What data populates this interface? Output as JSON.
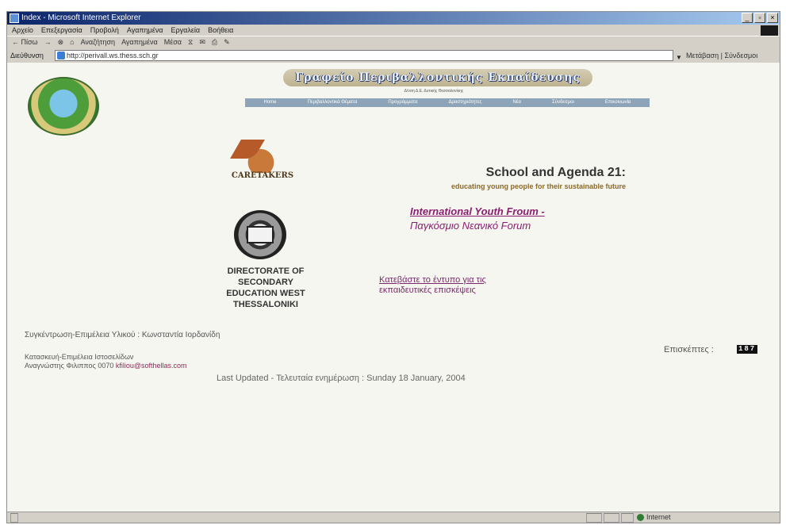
{
  "window": {
    "title": "Index - Microsoft Internet Explorer",
    "buttons": [
      "_",
      "▫",
      "×"
    ]
  },
  "menu": [
    "Αρχείο",
    "Επεξεργασία",
    "Προβολή",
    "Αγαπημένα",
    "Εργαλεία",
    "Βοήθεια"
  ],
  "toolbar": [
    "← Πίσω",
    "→",
    "⊗",
    "⌂",
    "Αναζήτηση",
    "Αγαπημένα",
    "Μέσα",
    "⧖",
    "✉",
    "⎙",
    "✎"
  ],
  "address": {
    "label": "Διεύθυνση",
    "url": "http://perivall.ws.thess.sch.gr",
    "go_label": "Μετάβαση",
    "links_label": "Σύνδεσμοι"
  },
  "page": {
    "banner": "Γραφείο Περιβαλλοντικής Εκπαίδευσης",
    "banner_sub": "Δ/νση Δ.Ε. Δυτικής Θεσσαλονίκης",
    "nav": [
      "Home",
      "Περιβαλλοντικά Θέματα",
      "Προγράμματα",
      "Δραστηριότητες",
      "Νέα",
      "Σύνδεσμοι",
      "Επικοινωνία"
    ],
    "caretakers": "CARETAKERS",
    "agenda_title": "School and Agenda 21:",
    "agenda_sub": "educating young people for their sustainable future",
    "forum_en": "International Youth Froum -",
    "forum_gr": "Παγκόσμιο Νεανικό Forum",
    "directorate": [
      "DIRECTORATE OF",
      "SECONDARY",
      "EDUCATION WEST",
      "THESSALONIKI"
    ],
    "download_l1": "Κατεβάστε το έντυπο για τις",
    "download_l2": "εκπαιδευτικές επισκέψεις",
    "coordinator": "Συγκέντρωση-Επιμέλεια Υλικού : Κωνσταντία Ιορδανίδη",
    "visits_label": "Επισκέπτες :",
    "visits_count": "187",
    "office": "Κατασκευή-Επιμέλεια Ιστοσελίδων",
    "fax_label": "Αναγνώστης Φιλιππος 0070",
    "fax_email": "kfiliou@softhellas.com",
    "updated": "Last Updated - Τελευταία ενημέρωση : Sunday 18 January, 2004"
  },
  "status": {
    "zone": "Internet"
  },
  "colors": {
    "link": "#8a1e70",
    "titlebar": "#0a246a",
    "navbar": "#8da3b7"
  }
}
